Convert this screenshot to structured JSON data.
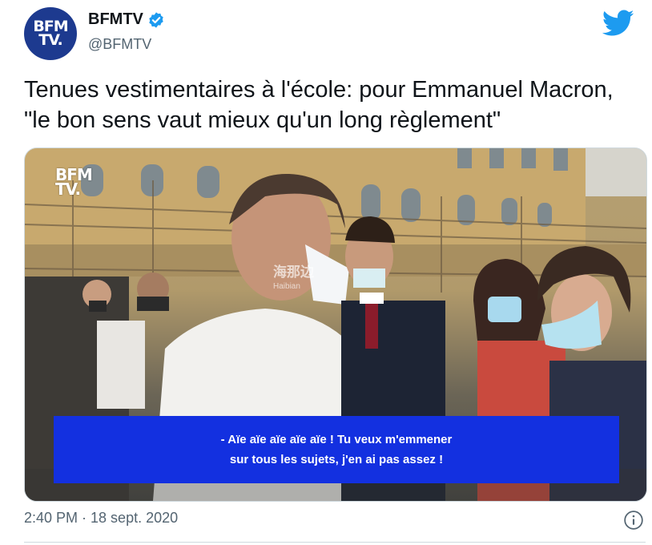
{
  "author": {
    "avatar_text_line1": "BFM",
    "avatar_text_line2": "TV.",
    "name": "BFMTV",
    "handle": "@BFMTV"
  },
  "tweet": {
    "text_line1": "Tenues vestimentaires à l'école: pour Emmanuel Macron,",
    "text_line2": "\"le bon sens vaut mieux qu'un long règlement\""
  },
  "media": {
    "channel_logo_line1": "BFM",
    "channel_logo_line2": "TV.",
    "watermark_line1": "海那边",
    "watermark_line2": "Haibian",
    "subtitle_line1": "- Aïe aïe aïe aïe aïe ! Tu veux m'emmener",
    "subtitle_line2": "sur tous les sujets, j'en ai pas assez !"
  },
  "meta": {
    "timestamp": "2:40 PM · 18 sept. 2020"
  },
  "colors": {
    "twitter_blue": "#1d9bf0",
    "subtitle_bg": "#1330e0",
    "avatar_bg": "#1d3a8f"
  },
  "icons": [
    "verified-badge-icon",
    "twitter-bird-icon",
    "info-icon"
  ]
}
